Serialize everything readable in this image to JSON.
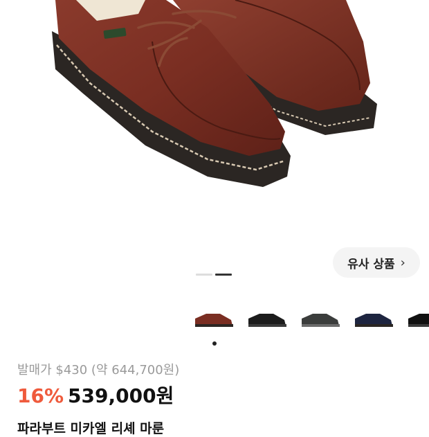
{
  "product": {
    "image_alt": "paraboot-michael-shoes",
    "similar_button_label": "유사 상품",
    "chevron": "›",
    "pager": {
      "count": 2,
      "active": 2
    },
    "thumbnails": [
      "brown-shoe-thumb",
      "black-shoe-thumb",
      "gray-shoe-thumb",
      "navy-shoe-thumb",
      "black-velvet-shoe-thumb"
    ],
    "retail_price_text": "발매가 $430 (약 644,700원)",
    "discount_text": "16%",
    "price_text": "539,000원",
    "title": "파라부트 미카엘 리셰 마룬"
  },
  "colors": {
    "discount": "#ef5a3c",
    "text": "#111111",
    "muted": "#9a9a9a",
    "shoe": "#7a2e22"
  }
}
